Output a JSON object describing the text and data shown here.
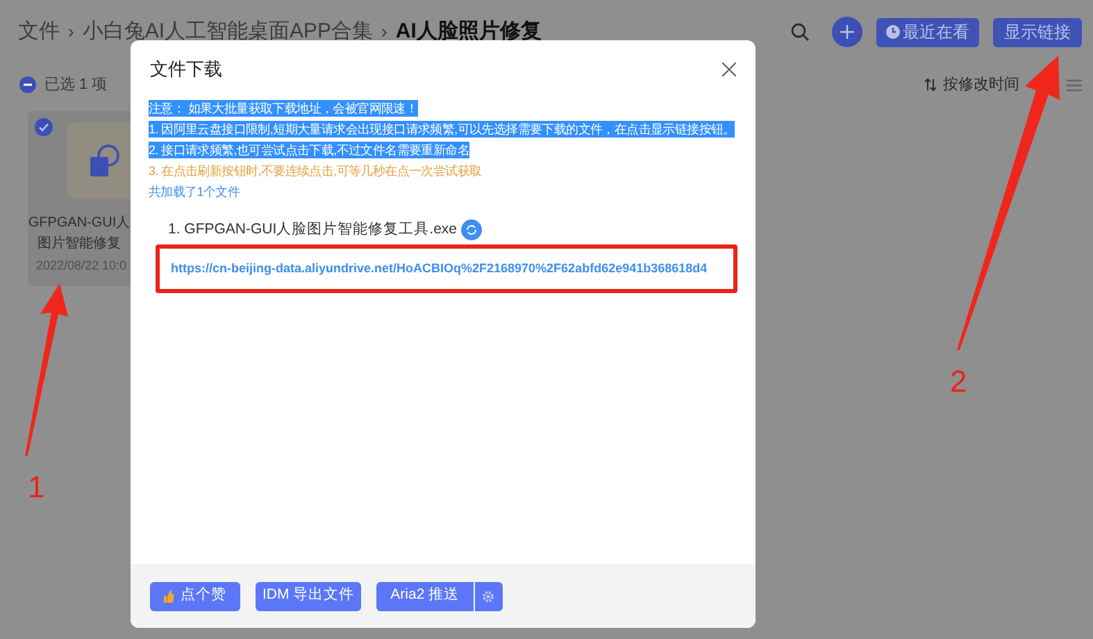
{
  "breadcrumb": [
    {
      "label": "文件",
      "current": false
    },
    {
      "label": "小白兔AI人工智能桌面APP合集",
      "current": false
    },
    {
      "label": "AI人脸照片修复",
      "current": true
    }
  ],
  "breadcrumb_separators": [
    "›",
    "›"
  ],
  "toolbar": {
    "recent_button": "最近在看",
    "show_links_button": "显示链接"
  },
  "selection": {
    "label": "已选 1 项"
  },
  "sort": {
    "label": "按修改时间"
  },
  "file_card": {
    "name_lines": [
      "GFPGAN-GUI人",
      "图片智能修复"
    ],
    "date": "2022/08/22 10:0",
    "checked": true
  },
  "dialog": {
    "title": "文件下载",
    "notices": [
      {
        "text": "注意：  如果大批量获取下载地址，会被官网限速！",
        "kind": "highlight"
      },
      {
        "text": "1. 因阿里云盘接口限制,短期大量请求会出现接口请求频繁,可以先选择需要下载的文件，在点击显示链接按钮。",
        "kind": "highlight"
      },
      {
        "text": "2. 接口请求频繁,也可尝试点击下载,不过文件名需要重新命名",
        "kind": "highlight"
      },
      {
        "text": "3. 在点击刷新按钮时,不要连续点击,可等几秒在点一次尝试获取",
        "kind": "warning"
      },
      {
        "text": "共加载了1个文件",
        "kind": "info"
      }
    ],
    "files": [
      {
        "name": "1. GFPGAN-GUI人脸图片智能修复工具.exe",
        "link": "https://cn-beijing-data.aliyundrive.net/HoACBIOq%2F2168970%2F62abfd62e941b368618d4"
      }
    ],
    "buttons": [
      {
        "label": "点个赞",
        "kind": "like"
      },
      {
        "label": "IDM 导出文件",
        "kind": "plain"
      },
      {
        "label": "Aria2 推送",
        "kind": "split"
      }
    ]
  },
  "annotations": [
    {
      "label": "1"
    },
    {
      "label": "2"
    }
  ]
}
